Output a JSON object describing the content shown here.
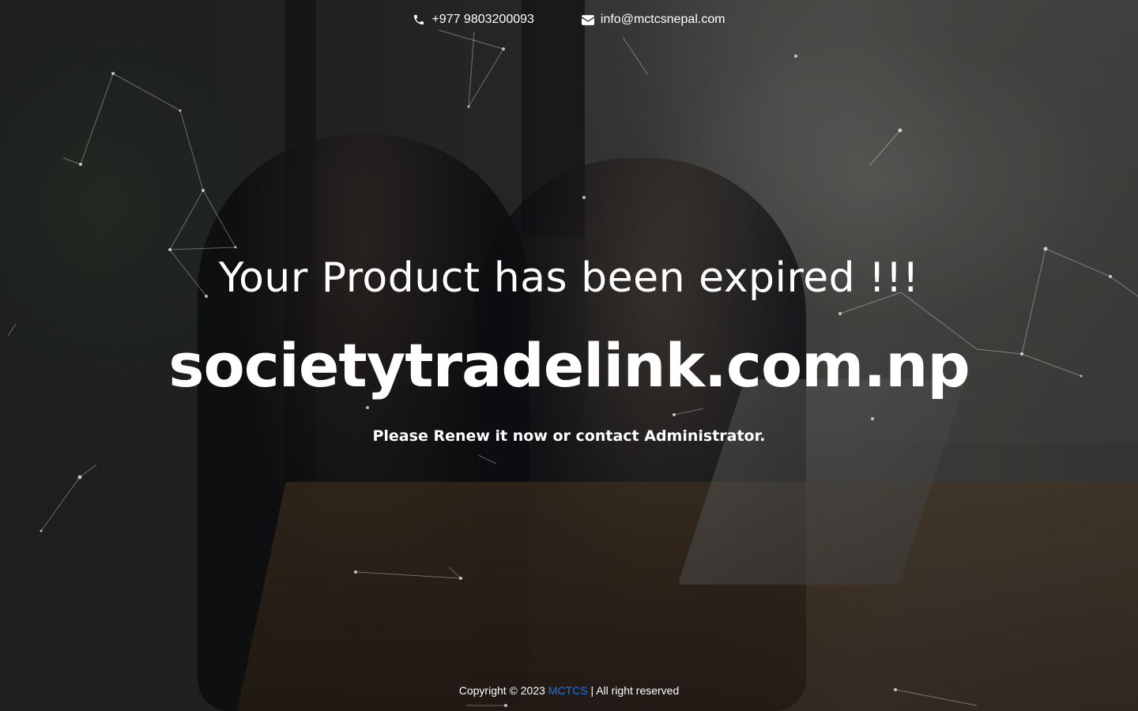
{
  "topbar": {
    "phone": {
      "icon": "phone-icon",
      "text": "+977 9803200093"
    },
    "email": {
      "icon": "envelope-icon",
      "text": "info@mctcsnepal.com"
    }
  },
  "main": {
    "headline": "Your Product has been expired !!!",
    "domain": "societytradelink.com.np",
    "notice": "Please Renew it now or contact Administrator."
  },
  "footer": {
    "prefix": "Copyright © 2023 ",
    "brand": "MCTCS",
    "suffix": " | All right reserved"
  },
  "colors": {
    "text": "#ffffff",
    "link": "#1a73e8",
    "overlay": "rgba(0,0,0,0.45)"
  }
}
